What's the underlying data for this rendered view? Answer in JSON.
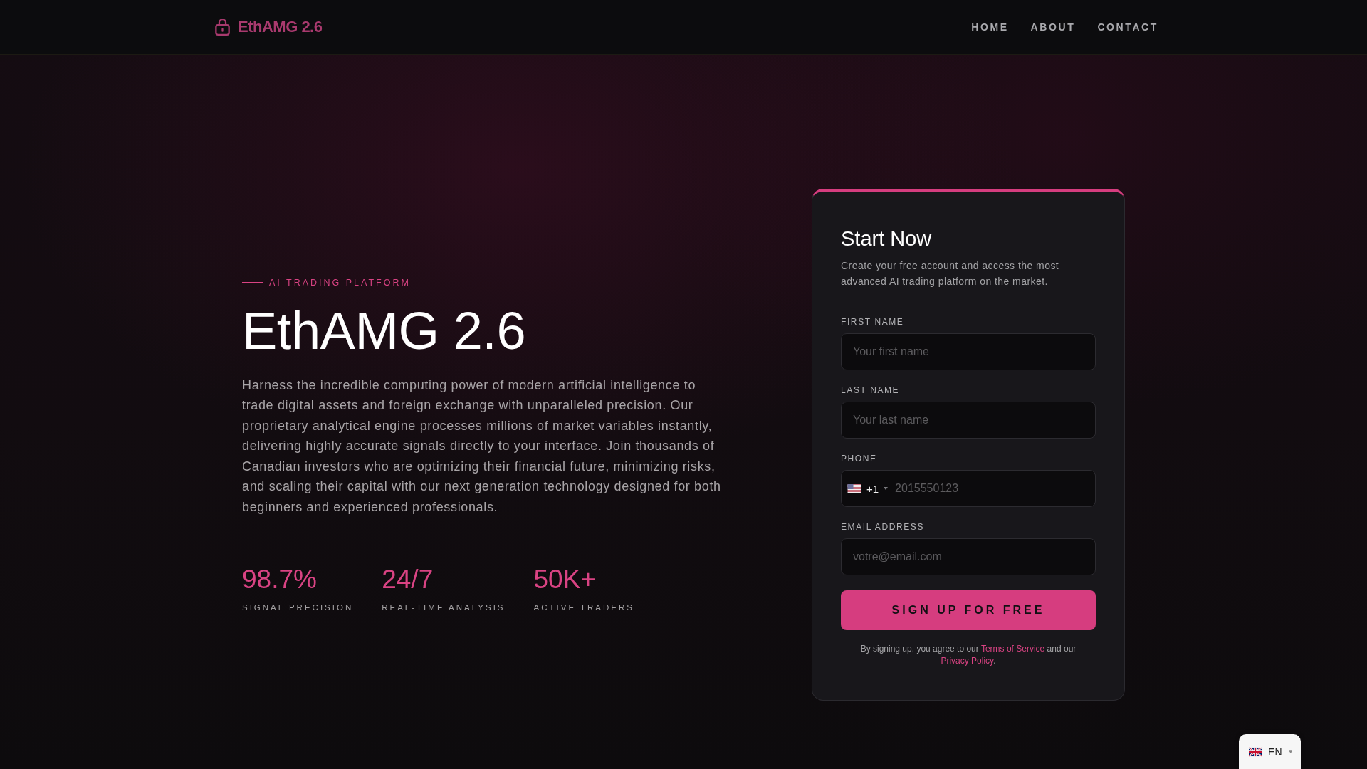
{
  "header": {
    "logo": {
      "text": "EthAMG 2.6"
    },
    "nav": [
      {
        "label": "HOME"
      },
      {
        "label": "ABOUT"
      },
      {
        "label": "CONTACT"
      }
    ]
  },
  "hero": {
    "eyebrow": "AI TRADING PLATFORM",
    "title": "EthAMG 2.6",
    "description": "Harness the incredible computing power of modern artificial intelligence to trade digital assets and foreign exchange with unparalleled precision. Our proprietary analytical engine processes millions of market variables instantly, delivering highly accurate signals directly to your interface. Join thousands of Canadian investors who are optimizing their financial future, minimizing risks, and scaling their capital with our next generation technology designed for both beginners and experienced professionals.",
    "stats": [
      {
        "value": "98.7%",
        "label": "SIGNAL PRECISION"
      },
      {
        "value": "24/7",
        "label": "REAL-TIME ANALYSIS"
      },
      {
        "value": "50K+",
        "label": "ACTIVE TRADERS"
      }
    ]
  },
  "signup_form": {
    "title": "Start Now",
    "subtitle": "Create your free account and access the most advanced AI trading platform on the market.",
    "fields": [
      {
        "kind": "text",
        "label": "FIRST NAME",
        "placeholder": "Your first name"
      },
      {
        "kind": "text",
        "label": "LAST NAME",
        "placeholder": "Your last name"
      },
      {
        "kind": "phone",
        "label": "PHONE",
        "country_code": "+1",
        "placeholder": "2015550123"
      },
      {
        "kind": "email",
        "label": "EMAIL ADDRESS",
        "placeholder": "votre@email.com"
      }
    ],
    "submit_button": "SIGN UP FOR FREE",
    "legal": [
      {
        "kind": "text",
        "text": "By signing up, you agree to our "
      },
      {
        "kind": "link",
        "text": "Terms of Service"
      },
      {
        "kind": "text",
        "text": " and our "
      },
      {
        "kind": "link",
        "text": "Privacy Policy"
      },
      {
        "kind": "text",
        "text": "."
      }
    ]
  },
  "language_switcher": {
    "label": "EN"
  }
}
